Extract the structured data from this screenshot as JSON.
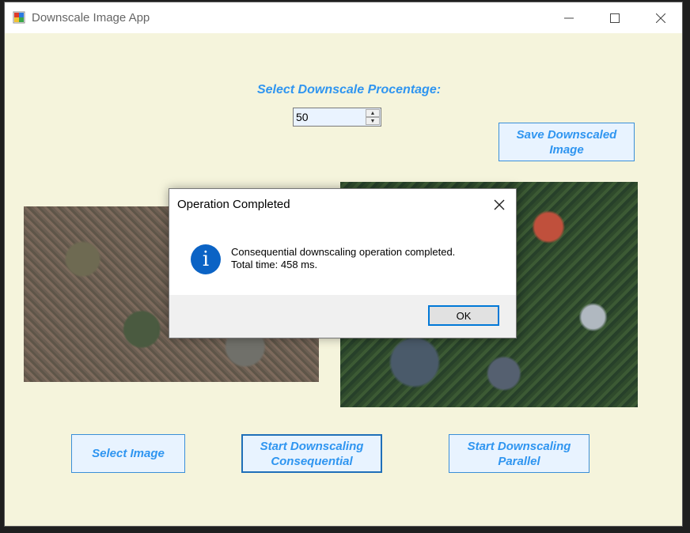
{
  "window": {
    "title": "Downscale Image App"
  },
  "controls": {
    "percentage_label": "Select Downscale Procentage:",
    "percentage_value": "50",
    "save_button": "Save Downscaled Image",
    "select_button": "Select Image",
    "consequential_button": "Start Downscaling Consequential",
    "parallel_button": "Start Downscaling Parallel"
  },
  "dialog": {
    "title": "Operation Completed",
    "message_line1": "Consequential downscaling operation completed.",
    "message_line2": "Total time: 458 ms.",
    "ok_button": "OK"
  },
  "colors": {
    "accent": "#2f95f0",
    "window_bg": "#f5f4dc",
    "info_icon": "#0b63c5"
  }
}
